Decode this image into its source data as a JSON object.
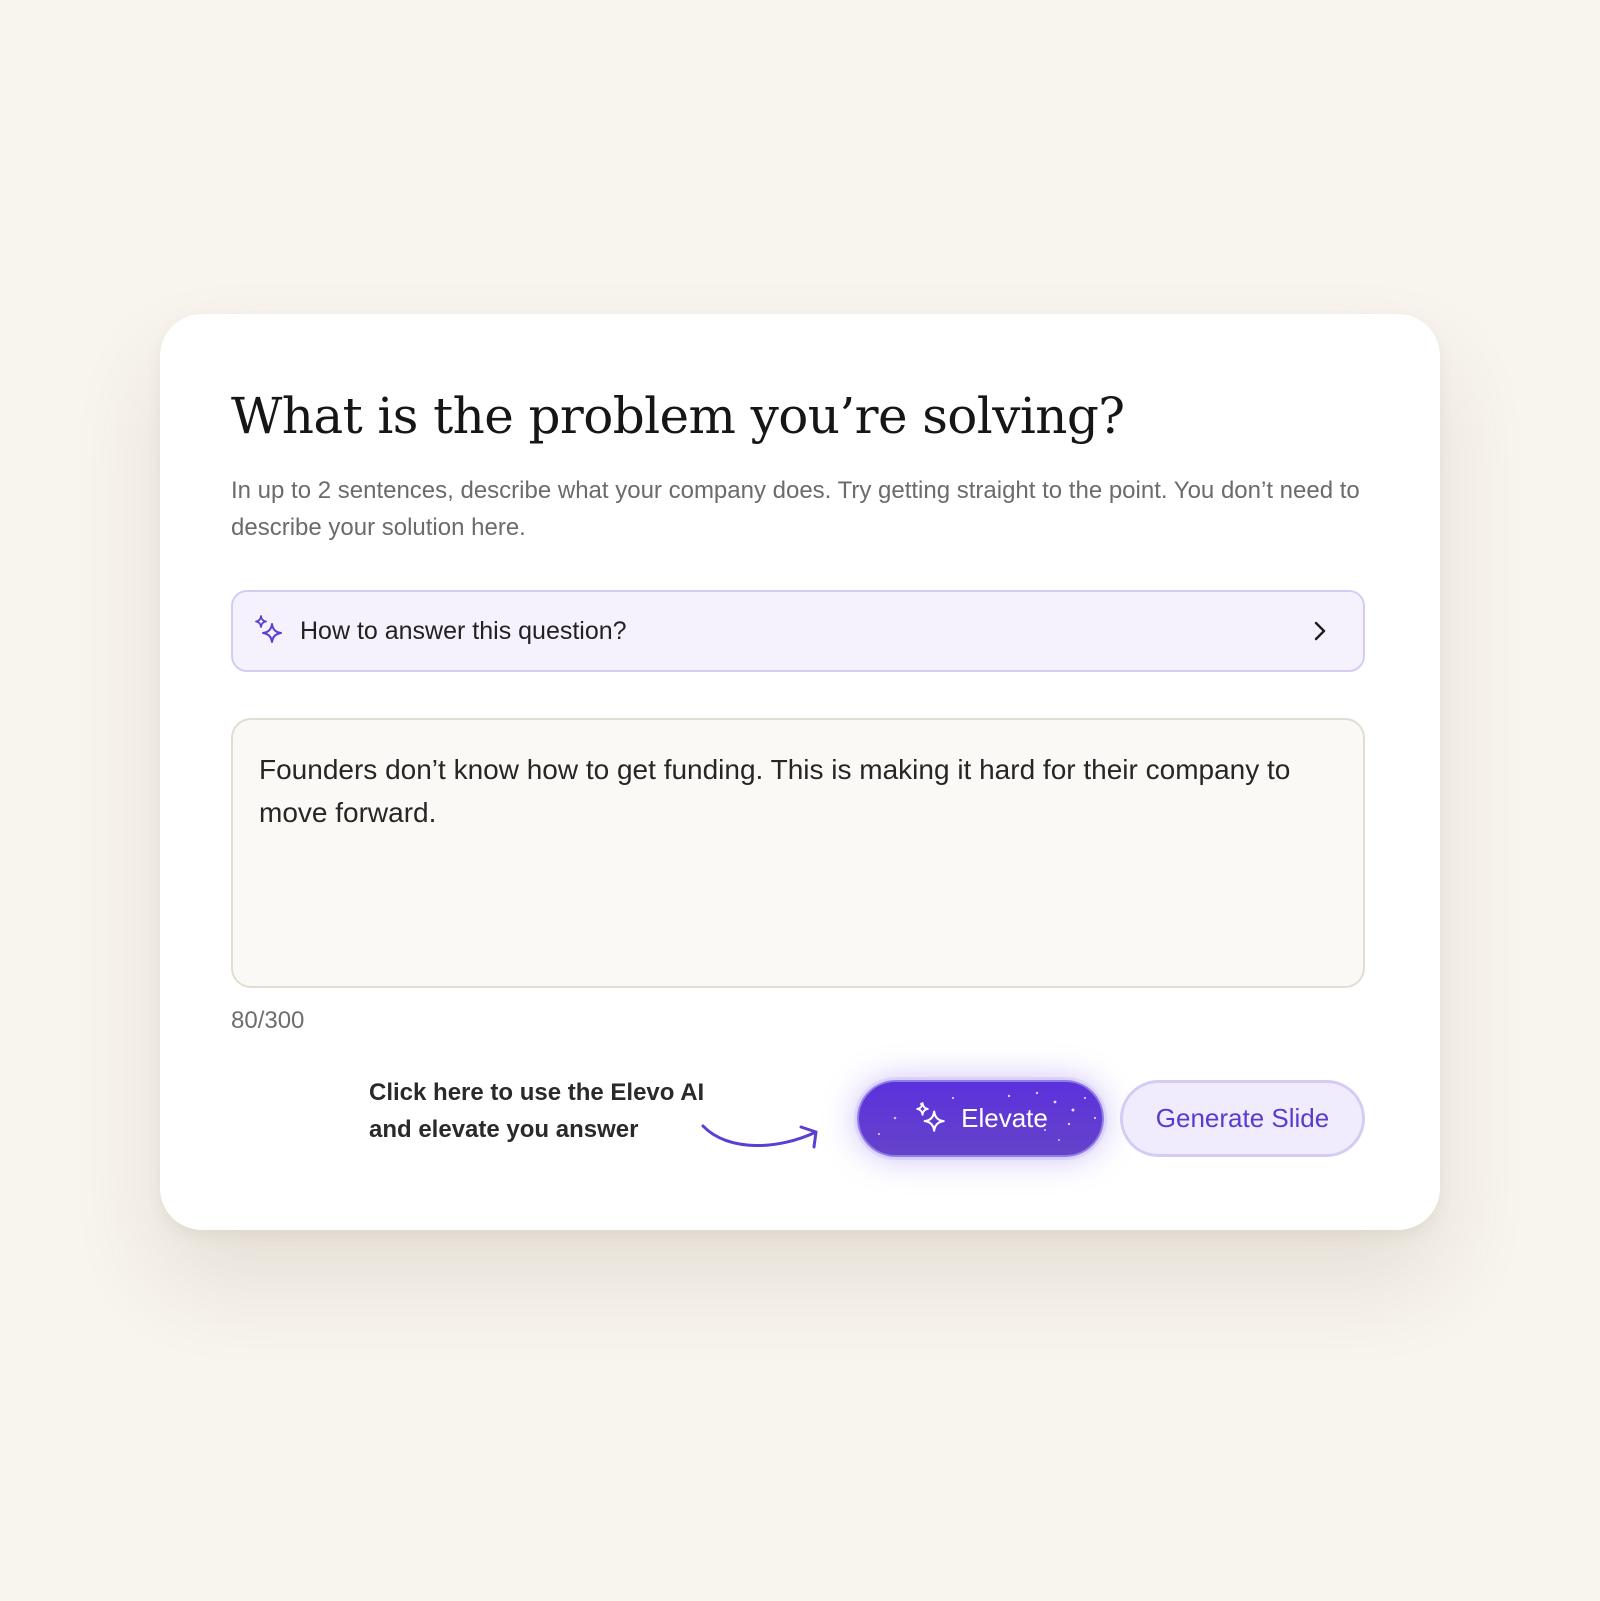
{
  "question": {
    "title": "What is the problem you’re solving?",
    "description": "In up to 2 sentences, describe what your company does. Try getting straight to the point. You don’t need to describe your solution here."
  },
  "help": {
    "label": "How to answer this question?",
    "icon": "sparkle-icon",
    "chevron_icon": "chevron-right-icon"
  },
  "answer": {
    "value": "Founders don’t know how to get funding. This is making it hard for their company to move forward.",
    "counter": "80/300"
  },
  "hint": {
    "text": "Click here to use the Elevo AI and elevate you answer"
  },
  "actions": {
    "elevate_label": "Elevate",
    "generate_label": "Generate Slide"
  },
  "colors": {
    "background": "#f8f4ee",
    "accent": "#5b31dd",
    "help_background": "#f5f2fd",
    "secondary_button_bg": "#f1ecfd"
  }
}
